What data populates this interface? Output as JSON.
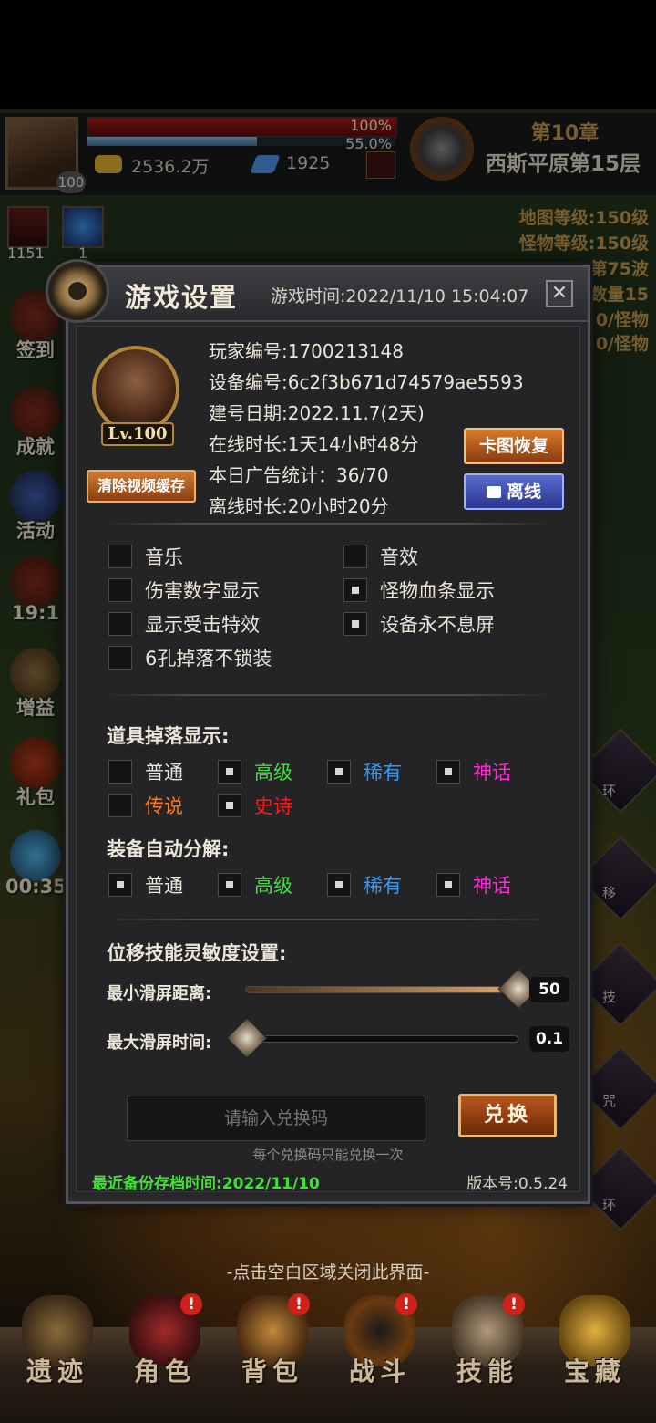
{
  "hud": {
    "hp_percent": "100%",
    "mp_percent": "55.0%",
    "gold": "2536.2万",
    "gems": "1925",
    "avatar_level": "100",
    "chapter": "第10章",
    "stage": "西斯平原第15层"
  },
  "side_info": {
    "map_level": "地图等级:150级",
    "monster_level": "怪物等级:150级",
    "wave": "第75波",
    "count": "数量15",
    "per_monster_1": "0/怪物",
    "per_monster_2": "0/怪物"
  },
  "left_skills": {
    "count_1": "1151",
    "count_2": "1"
  },
  "side_menu": {
    "sign_in": "签到",
    "achievement": "成就",
    "activity": "活动",
    "timer_1": "19:1",
    "gain": "增益",
    "gift": "礼包",
    "timer_2": "00:35"
  },
  "right_slots": {
    "s1": "环",
    "s2": "移",
    "s3": "技",
    "s4": "咒",
    "s5": "环"
  },
  "dialog": {
    "title": "游戏设置",
    "game_time": "游戏时间:2022/11/10 15:04:07",
    "close_symbol": "✕",
    "player": {
      "level_badge": "Lv.100",
      "player_id": "玩家编号:1700213148",
      "device_id": "设备编号:6c2f3b671d74579ae5593",
      "created": "建号日期:2022.11.7(2天)",
      "online": "在线时长:1天14小时48分",
      "ads": "本日广告统计：36/70",
      "offline": "离线时长:20小时20分"
    },
    "buttons": {
      "clear_cache": "清除视频缓存",
      "map_restore": "卡图恢复",
      "offline": "离线",
      "redeem": "兑换"
    },
    "toggles": [
      {
        "label": "音乐",
        "checked": false
      },
      {
        "label": "音效",
        "checked": false
      },
      {
        "label": "伤害数字显示",
        "checked": false
      },
      {
        "label": "怪物血条显示",
        "checked": true
      },
      {
        "label": "显示受击特效",
        "checked": false
      },
      {
        "label": "设备永不息屏",
        "checked": true
      },
      {
        "label": "6孔掉落不锁装",
        "checked": false
      }
    ],
    "drop_display": {
      "title": "道具掉落显示:",
      "items": [
        {
          "label": "普通",
          "checked": false
        },
        {
          "label": "高级",
          "checked": true
        },
        {
          "label": "稀有",
          "checked": true
        },
        {
          "label": "神话",
          "checked": true
        },
        {
          "label": "传说",
          "checked": false
        },
        {
          "label": "史诗",
          "checked": true
        }
      ]
    },
    "auto_decompose": {
      "title": "装备自动分解:",
      "items": [
        {
          "label": "普通",
          "checked": true
        },
        {
          "label": "高级",
          "checked": true
        },
        {
          "label": "稀有",
          "checked": true
        },
        {
          "label": "神话",
          "checked": true
        }
      ]
    },
    "sensitivity": {
      "title": "位移技能灵敏度设置:",
      "min_distance_label": "最小滑屏距离:",
      "min_distance_value": "50",
      "min_distance_fraction": 1.0,
      "max_time_label": "最大滑屏时间:",
      "max_time_value": "0.1",
      "max_time_fraction": 0.0
    },
    "redeem": {
      "placeholder": "请输入兑换码",
      "note": "每个兑换码只能兑换一次"
    },
    "backup_time": "最近备份存档时间:2022/11/10",
    "version": "版本号:0.5.24"
  },
  "close_hint": "-点击空白区域关闭此界面-",
  "bottom_nav": [
    {
      "label": "遗迹",
      "badge": ""
    },
    {
      "label": "角色",
      "badge": "!"
    },
    {
      "label": "背包",
      "badge": "!"
    },
    {
      "label": "战斗",
      "badge": "!"
    },
    {
      "label": "技能",
      "badge": "!"
    },
    {
      "label": "宝藏",
      "badge": ""
    }
  ],
  "colors": {
    "rarity_normal": "#ece6da",
    "rarity_advanced": "#44e03a",
    "rarity_rare": "#2a9cff",
    "rarity_myth": "#ff2ad6",
    "rarity_legend": "#ff7a1a",
    "rarity_epic": "#ff1a1a",
    "backup_text": "#44e03a"
  }
}
